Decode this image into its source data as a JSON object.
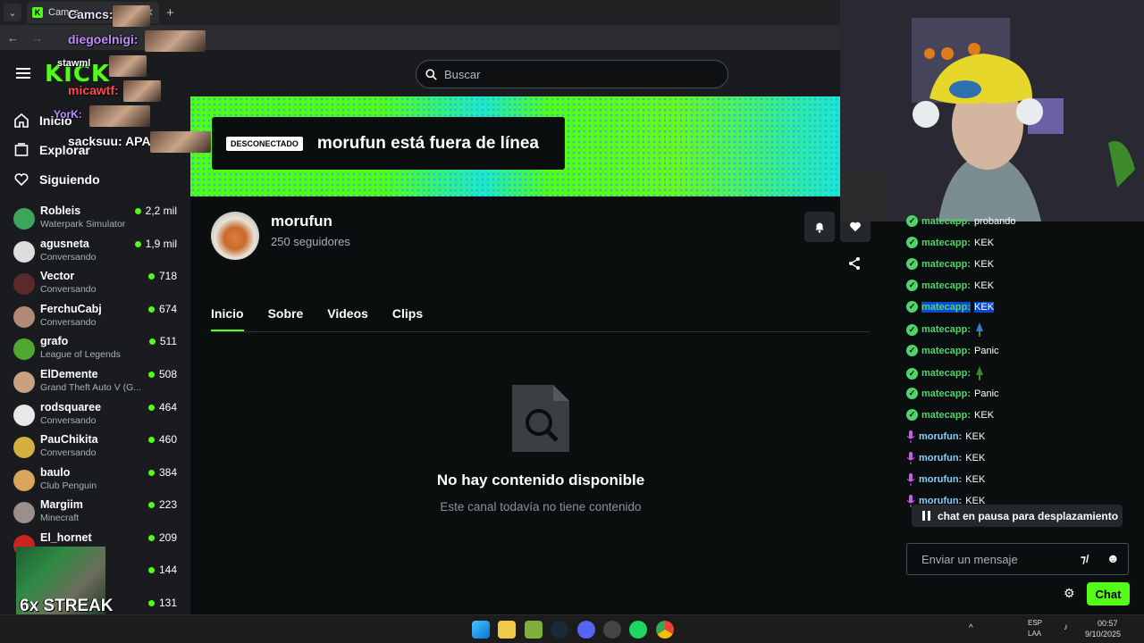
{
  "browser": {
    "tab_label": "Camcs",
    "new_tab": "+"
  },
  "header": {
    "logo": "KICK",
    "search_placeholder": "Buscar"
  },
  "nav": {
    "inicio": "Inicio",
    "explorar": "Explorar",
    "siguiendo": "Siguiendo"
  },
  "following": [
    {
      "name": "Robleis",
      "game": "Waterpark Simulator",
      "viewers": "2,2 mil"
    },
    {
      "name": "agusneta",
      "game": "Conversando",
      "viewers": "1,9 mil"
    },
    {
      "name": "Vector",
      "game": "Conversando",
      "viewers": "718"
    },
    {
      "name": "FerchuCabj",
      "game": "Conversando",
      "viewers": "674"
    },
    {
      "name": "grafo",
      "game": "League of Legends",
      "viewers": "511"
    },
    {
      "name": "ElDemente",
      "game": "Grand Theft Auto V (G...",
      "viewers": "508"
    },
    {
      "name": "rodsquaree",
      "game": "Conversando",
      "viewers": "464"
    },
    {
      "name": "PauChikita",
      "game": "Conversando",
      "viewers": "460"
    },
    {
      "name": "baulo",
      "game": "Club Penguin",
      "viewers": "384"
    },
    {
      "name": "Margiim",
      "game": "Minecraft",
      "viewers": "223"
    },
    {
      "name": "El_hornet",
      "game": "",
      "viewers": "209"
    },
    {
      "name": "",
      "game": "",
      "viewers": "144"
    },
    {
      "name": "",
      "game": "",
      "viewers": "131"
    }
  ],
  "overlay": {
    "alerts": [
      "Camcs:",
      "diegoelnigi:",
      "stawml",
      "micawtf:",
      "YorK:",
      "sacksuu: APA"
    ],
    "streak": "6x STREAK"
  },
  "banner": {
    "badge": "DESCONECTADO",
    "title": "morufun está fuera de línea"
  },
  "channel": {
    "name": "morufun",
    "followers": "250 seguidores",
    "tabs": [
      "Inicio",
      "Sobre",
      "Videos",
      "Clips"
    ],
    "active_tab": "Inicio",
    "empty_title": "No hay contenido disponible",
    "empty_sub": "Este canal todavía no tiene contenido"
  },
  "chat": {
    "messages": [
      {
        "user": "matecapp:",
        "text": "probando",
        "type": "verified"
      },
      {
        "user": "matecapp:",
        "text": "KEK",
        "type": "verified"
      },
      {
        "user": "matecapp:",
        "text": "KEK",
        "type": "verified"
      },
      {
        "user": "matecapp:",
        "text": "KEK",
        "type": "verified"
      },
      {
        "user": "matecapp:",
        "text": "KEK",
        "type": "verified",
        "highlight": true
      },
      {
        "user": "matecapp:",
        "text": "",
        "type": "verified",
        "emote": true
      },
      {
        "user": "matecapp:",
        "text": "Panic",
        "type": "verified"
      },
      {
        "user": "matecapp:",
        "text": "",
        "type": "verified",
        "emote": true
      },
      {
        "user": "matecapp:",
        "text": "Panic",
        "type": "verified"
      },
      {
        "user": "matecapp:",
        "text": "KEK",
        "type": "verified"
      },
      {
        "user": "morufun:",
        "text": "KEK",
        "type": "broadcaster"
      },
      {
        "user": "morufun:",
        "text": "KEK",
        "type": "broadcaster"
      },
      {
        "user": "morufun:",
        "text": "KEK",
        "type": "broadcaster"
      },
      {
        "user": "morufun:",
        "text": "KEK",
        "type": "broadcaster"
      }
    ],
    "paused": "chat en pausa para desplazamiento",
    "input_placeholder": "Enviar un mensaje",
    "send_label": "Chat"
  },
  "taskbar": {
    "lang": "ESP",
    "lang2": "LAA",
    "time": "00:57",
    "date": "9/10/2025"
  },
  "colors": {
    "accent": "#53fc18",
    "verified_user": "#4fd36b",
    "broadcaster_user": "#c85ce6"
  }
}
